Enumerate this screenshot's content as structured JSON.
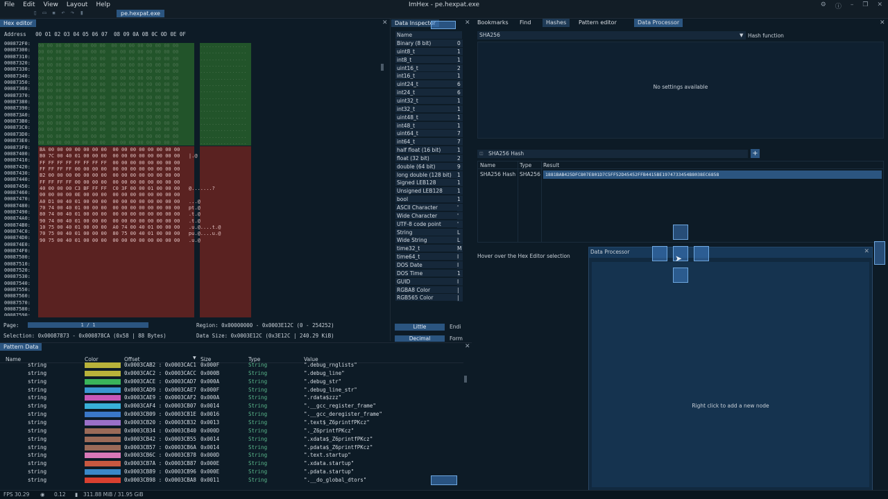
{
  "window": {
    "title": "ImHex - pe.hexpat.exe",
    "menu": [
      "File",
      "Edit",
      "View",
      "Layout",
      "Help"
    ],
    "file_tab": "pe.hexpat.exe"
  },
  "hex_editor": {
    "tab": "Hex editor",
    "header": "Address   00 01 02 03 04 05 06 07  08 09 0A 0B 0C 0D 0E 0F",
    "addresses": [
      "000872F0:",
      "00087300:",
      "00087310:",
      "00087320:",
      "00087330:",
      "00087340:",
      "00087350:",
      "00087360:",
      "00087370:",
      "00087380:",
      "00087390:",
      "000873A0:",
      "000873B0:",
      "000873C0:",
      "000873D0:",
      "000873E0:",
      "000873F0:",
      "00087400:",
      "00087410:",
      "00087420:",
      "00087430:",
      "00087440:",
      "00087450:",
      "00087460:",
      "00087470:",
      "00087480:",
      "00087490:",
      "000874A0:",
      "000874B0:",
      "000874C0:",
      "000874D0:",
      "000874E0:",
      "000874F0:",
      "00087500:",
      "00087510:",
      "00087520:",
      "00087530:",
      "00087540:",
      "00087550:",
      "00087560:",
      "00087570:",
      "00087580:",
      "00087590:",
      "000875A0:"
    ],
    "red_rows": [
      "BA 00 00 00 00 00 00 00  00 00 00 00 00 00 00 00",
      "B0 7C 00 40 01 00 00 00  00 00 00 00 00 00 00 00   |.@",
      "FF FF FF FF FF FF FF FF  00 00 00 00 00 00 00 00",
      "FF FF FF FF 00 00 00 00  00 00 00 00 00 00 00 00",
      "B2 00 00 00 00 00 00 00  00 00 00 00 00 00 00 00",
      "FF FF FF FF 00 00 00 00  00 00 00 00 00 00 00 00",
      "40 00 00 00 C3 BF FF FF  C0 3F 00 00 01 00 00 00   @.......?",
      "00 00 00 00 0E 00 00 00  00 00 00 00 00 00 00 00",
      "A0 D1 00 40 01 00 00 00  00 00 00 00 00 00 00 00   ...@",
      "70 74 00 40 01 00 00 00  00 00 00 00 00 00 00 00   pt.@",
      "80 74 00 40 01 00 00 00  00 00 00 00 00 00 00 00   .t.@",
      "90 74 00 40 01 00 00 00  00 00 00 00 00 00 00 00   .t.@",
      "10 75 00 40 01 00 00 00  A0 74 00 40 01 00 00 00   .u.@....t.@",
      "70 75 00 40 01 00 00 00  80 75 00 40 01 00 00 00   pu.@....u.@",
      "90 75 00 40 01 00 00 00  00 00 00 00 00 00 00 00   .u.@"
    ],
    "page_label": "Page:",
    "page_value": "1 / 1",
    "region": "Region: 0x00000000 - 0x0003E12C (0 - 254252)",
    "selection": "Selection: 0x00087873 - 0x000878CA (0x58 | 88 Bytes)",
    "data_size": "Data Size: 0x0003E12C (0x3E12C | 240.29 KiB)"
  },
  "inspector": {
    "tab": "Data Inspector",
    "col_name": "Name",
    "col_value": "Value",
    "rows": [
      {
        "name": "Binary (8 bit)",
        "value": "0"
      },
      {
        "name": "uint8_t",
        "value": "1"
      },
      {
        "name": "int8_t",
        "value": "1"
      },
      {
        "name": "uint16_t",
        "value": "2"
      },
      {
        "name": "int16_t",
        "value": "1"
      },
      {
        "name": "uint24_t",
        "value": "6"
      },
      {
        "name": "int24_t",
        "value": "6"
      },
      {
        "name": "uint32_t",
        "value": "1"
      },
      {
        "name": "int32_t",
        "value": "1"
      },
      {
        "name": "uint48_t",
        "value": "1"
      },
      {
        "name": "int48_t",
        "value": "1"
      },
      {
        "name": "uint64_t",
        "value": "7"
      },
      {
        "name": "int64_t",
        "value": "7"
      },
      {
        "name": "half float (16 bit)",
        "value": "1"
      },
      {
        "name": "float (32 bit)",
        "value": "2"
      },
      {
        "name": "double (64 bit)",
        "value": "9"
      },
      {
        "name": "long double (128 bit)",
        "value": "1"
      },
      {
        "name": "Signed LEB128",
        "value": "1"
      },
      {
        "name": "Unsigned LEB128",
        "value": "1"
      },
      {
        "name": "bool",
        "value": "1"
      },
      {
        "name": "ASCII Character",
        "value": "'"
      },
      {
        "name": "Wide Character",
        "value": "'"
      },
      {
        "name": "UTF-8 code point",
        "value": "'"
      },
      {
        "name": "String",
        "value": "L"
      },
      {
        "name": "Wide String",
        "value": "L"
      },
      {
        "name": "time32_t",
        "value": "M"
      },
      {
        "name": "time64_t",
        "value": "I"
      },
      {
        "name": "DOS Date",
        "value": "I"
      },
      {
        "name": "DOS Time",
        "value": "1"
      },
      {
        "name": "GUID",
        "value": "I"
      },
      {
        "name": "RGBA8 Color",
        "value": "|"
      },
      {
        "name": "RGB565 Color",
        "value": "|"
      }
    ],
    "endian_btn": "Little",
    "endian_label": "Endi",
    "format_btn": "Decimal",
    "format_label": "Form"
  },
  "pattern": {
    "tab": "Pattern Data",
    "headers": {
      "name": "Name",
      "color": "Color",
      "offset": "Offset",
      "size": "Size",
      "type": "Type",
      "value": "Value"
    },
    "rows": [
      {
        "name": "string",
        "color": "#b8b23a",
        "offset": "0x0003CAB2 : 0x0003CAC1",
        "size": "0x000F",
        "type": "String",
        "value": "\".debug_rnglists\""
      },
      {
        "name": "string",
        "color": "#b8b23a",
        "offset": "0x0003CAC2 : 0x0003CACC",
        "size": "0x000B",
        "type": "String",
        "value": "\".debug_line\""
      },
      {
        "name": "string",
        "color": "#3ab45a",
        "offset": "0x0003CACE : 0x0003CAD7",
        "size": "0x000A",
        "type": "String",
        "value": "\".debug_str\""
      },
      {
        "name": "string",
        "color": "#3a96d0",
        "offset": "0x0003CAD9 : 0x0003CAE7",
        "size": "0x000F",
        "type": "String",
        "value": "\".debug_line_str\""
      },
      {
        "name": "string",
        "color": "#c858b8",
        "offset": "0x0003CAE9 : 0x0003CAF2",
        "size": "0x000A",
        "type": "String",
        "value": "\".rdata$zzz\""
      },
      {
        "name": "string",
        "color": "#38b0d8",
        "offset": "0x0003CAF4 : 0x0003CB07",
        "size": "0x0014",
        "type": "String",
        "value": "\".__gcc_register_frame\""
      },
      {
        "name": "string",
        "color": "#3a78c8",
        "offset": "0x0003CB09 : 0x0003CB1E",
        "size": "0x0016",
        "type": "String",
        "value": "\".__gcc_deregister_frame\""
      },
      {
        "name": "string",
        "color": "#9a70c8",
        "offset": "0x0003CB20 : 0x0003CB32",
        "size": "0x0013",
        "type": "String",
        "value": "\".text$_Z6printfPKcz\""
      },
      {
        "name": "string",
        "color": "#9a6a58",
        "offset": "0x0003CB34 : 0x0003CB40",
        "size": "0x000D",
        "type": "String",
        "value": "\"._Z6printfPKcz\""
      },
      {
        "name": "string",
        "color": "#9a6a58",
        "offset": "0x0003CB42 : 0x0003CB55",
        "size": "0x0014",
        "type": "String",
        "value": "\".xdata$_Z6printfPKcz\""
      },
      {
        "name": "string",
        "color": "#9a6a58",
        "offset": "0x0003CB57 : 0x0003CB6A",
        "size": "0x0014",
        "type": "String",
        "value": "\".pdata$_Z6printfPKcz\""
      },
      {
        "name": "string",
        "color": "#d878b8",
        "offset": "0x0003CB6C : 0x0003CB78",
        "size": "0x000D",
        "type": "String",
        "value": "\".text.startup\""
      },
      {
        "name": "string",
        "color": "#c85840",
        "offset": "0x0003CB7A : 0x0003CB87",
        "size": "0x000E",
        "type": "String",
        "value": "\".xdata.startup\""
      },
      {
        "name": "string",
        "color": "#3a88c8",
        "offset": "0x0003CB89 : 0x0003CB96",
        "size": "0x000E",
        "type": "String",
        "value": "\".pdata.startup\""
      },
      {
        "name": "string",
        "color": "#d84030",
        "offset": "0x0003CB98 : 0x0003CBA8",
        "size": "0x0011",
        "type": "String",
        "value": "\".__do_global_dtors\""
      }
    ]
  },
  "right_tabs": [
    "Bookmarks",
    "Find",
    "Hashes",
    "Pattern editor",
    "Data Processor"
  ],
  "hashes": {
    "selected": "SHA256",
    "function_label": "Hash function",
    "settings_text": "No settings available",
    "hash_name": "SHA256 Hash",
    "add": "+",
    "table_headers": [
      "Name",
      "Type",
      "Result"
    ],
    "row": {
      "name": "SHA256 Hash",
      "type": "SHA256",
      "result": "1881BAB425DFC807E801D7C5FF52D45452FFB4415BE1974733454B8038EC6858"
    }
  },
  "processor": {
    "hover_text": "Hover over the Hex Editor selection",
    "float_title": "Data Processor",
    "empty_text": "Right click to add a new node"
  },
  "status": {
    "fps": "FPS 30.29",
    "cpu": "0.12",
    "mem": "311.88 MiB / 31.95 GiB"
  }
}
